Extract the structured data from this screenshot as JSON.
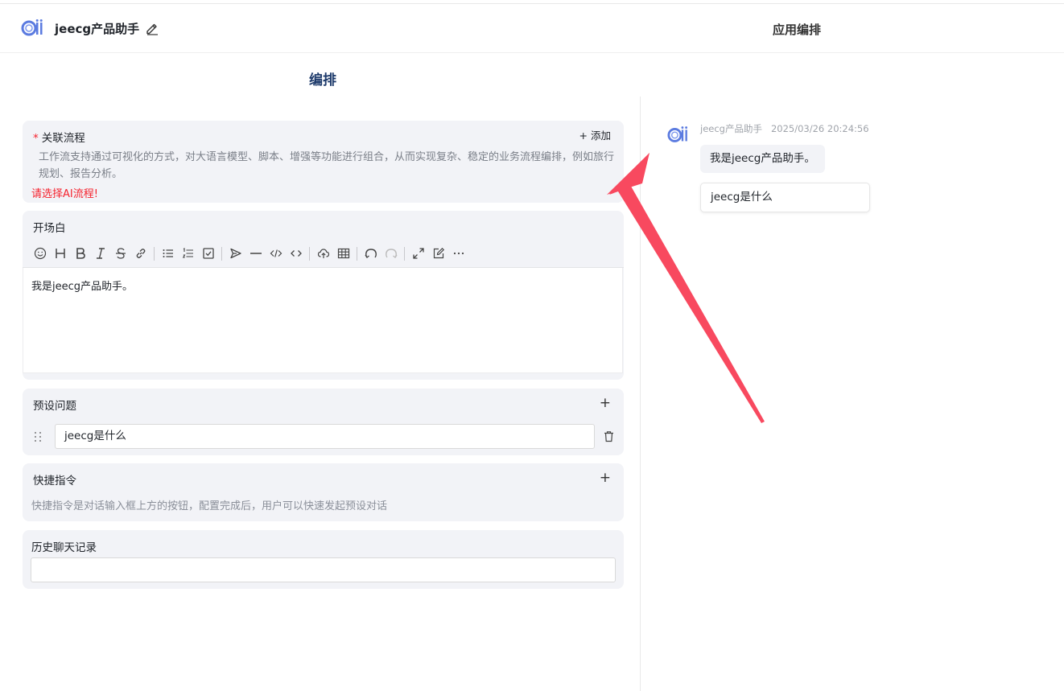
{
  "header": {
    "app_name": "jeecg产品助手",
    "title": "应用编排"
  },
  "main": {
    "heading": "编排",
    "flow": {
      "required_mark": "*",
      "title": "关联流程",
      "add_label": "+ 添加",
      "description": "工作流支持通过可视化的方式，对大语言模型、脚本、增强等功能进行组合，从而实现复杂、稳定的业务流程编排，例如旅行规划、报告分析。",
      "error": "请选择AI流程!"
    },
    "opening": {
      "title": "开场白",
      "content": "我是jeecg产品助手。"
    },
    "preset": {
      "title": "预设问题",
      "add_label": "+",
      "items": [
        "jeecg是什么"
      ]
    },
    "shortcut": {
      "title": "快捷指令",
      "add_label": "+",
      "hint": "快捷指令是对话输入框上方的按钮，配置完成后，用户可以快速发起预设对话"
    },
    "history": {
      "title": "历史聊天记录",
      "value": ""
    }
  },
  "preview": {
    "sender": "jeecg产品助手",
    "timestamp": "2025/03/26 20:24:56",
    "message": "我是jeecg产品助手。",
    "preset_question": "jeecg是什么"
  },
  "toolbar_icons": [
    "emoji-icon",
    "heading-icon",
    "bold-icon",
    "italic-icon",
    "strikethrough-icon",
    "link-icon",
    "bullet-list-icon",
    "ordered-list-icon",
    "checklist-icon",
    "quote-icon",
    "horizontal-rule-icon",
    "code-icon",
    "inline-code-icon",
    "upload-icon",
    "table-icon",
    "undo-icon",
    "redo-icon",
    "fullscreen-icon",
    "edit-preview-icon",
    "more-icon"
  ],
  "colors": {
    "accent": "#1d3a6b",
    "error": "#f5222d",
    "annotation_arrow": "#f8495f",
    "card_bg": "#f2f3f7"
  }
}
